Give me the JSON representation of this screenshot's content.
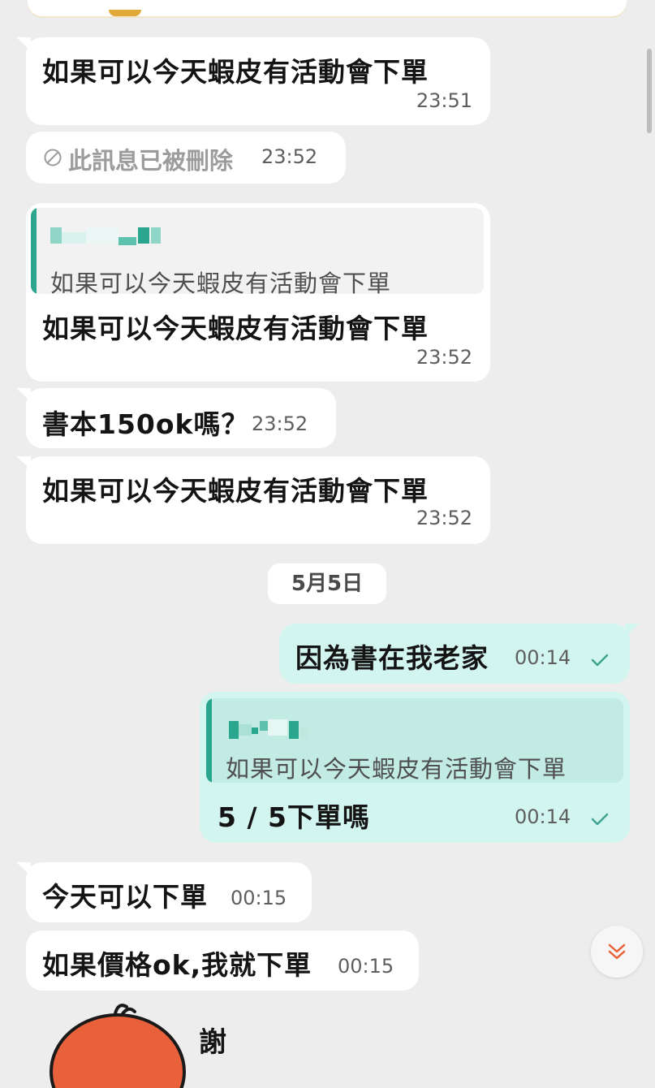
{
  "messages": [
    {
      "id": "m1",
      "text": "如果可以今天蝦皮有活動會下單",
      "time": "23:51"
    },
    {
      "id": "m2",
      "deleted_text": "此訊息已被刪除",
      "time": "23:52"
    },
    {
      "id": "m3",
      "quote": "如果可以今天蝦皮有活動會下單",
      "text": "如果可以今天蝦皮有活動會下單",
      "time": "23:52"
    },
    {
      "id": "m4",
      "text": "書本150ok嗎？",
      "time": "23:52"
    },
    {
      "id": "m5",
      "text": "如果可以今天蝦皮有活動會下單",
      "time": "23:52"
    },
    {
      "id": "m6",
      "text": "因為書在我老家",
      "time": "00:14"
    },
    {
      "id": "m7",
      "quote": "如果可以今天蝦皮有活動會下單",
      "text": "5 / 5下單嗎",
      "time": "00:14"
    },
    {
      "id": "m8",
      "text": "今天可以下單",
      "time": "00:15"
    },
    {
      "id": "m9",
      "text": "如果價格ok,我就下單",
      "time": "00:15"
    }
  ],
  "date_divider": "5月5日",
  "sticker_caption": "謝",
  "colors": {
    "background": "#ededed",
    "incoming_bubble": "#ffffff",
    "outgoing_bubble": "#d3f5ef",
    "accent": "#2aa58e",
    "read_check": "#3fa392",
    "scroll_button_arrow": "#e8613a",
    "sticker": "#e8613a"
  },
  "icons": {
    "deleted": "ban-icon",
    "read_receipt": "checkmark-icon",
    "scroll_down": "double-chevron-down-icon"
  }
}
